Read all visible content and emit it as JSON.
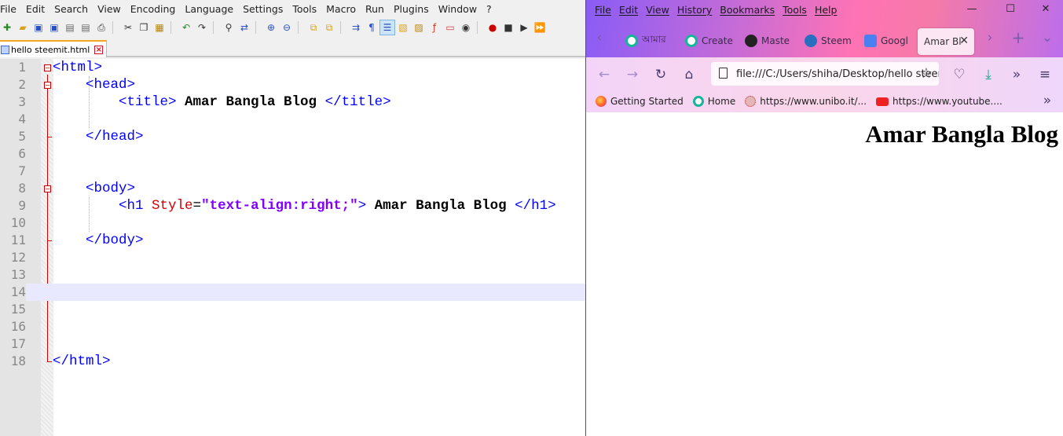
{
  "npp": {
    "menu": [
      "File",
      "Edit",
      "Search",
      "View",
      "Encoding",
      "Language",
      "Settings",
      "Tools",
      "Macro",
      "Run",
      "Plugins",
      "Window",
      "?"
    ],
    "tab_title": "hello steemit.html",
    "lines": [
      {
        "n": "1"
      },
      {
        "n": "2"
      },
      {
        "n": "3"
      },
      {
        "n": "4"
      },
      {
        "n": "5"
      },
      {
        "n": "6"
      },
      {
        "n": "7"
      },
      {
        "n": "8"
      },
      {
        "n": "9"
      },
      {
        "n": "10"
      },
      {
        "n": "11"
      },
      {
        "n": "12"
      },
      {
        "n": "13"
      },
      {
        "n": "14"
      },
      {
        "n": "15"
      },
      {
        "n": "16"
      },
      {
        "n": "17"
      },
      {
        "n": "18"
      }
    ],
    "code": {
      "l1": "<html>",
      "l2": "<head>",
      "l3_open": "<title>",
      "l3_text": " Amar Bangla Blog ",
      "l3_close": "</title>",
      "l5": "</head>",
      "l8": "<body>",
      "l9_open": "<h1 ",
      "l9_attr": "Style",
      "l9_eq": "=",
      "l9_val": "\"text-align:right;\"",
      "l9_gt": ">",
      "l9_text": " Amar Bangla Blog ",
      "l9_close": "</h1>",
      "l11": "</body>",
      "l18": "</html>"
    }
  },
  "firefox": {
    "menu": [
      "File",
      "Edit",
      "View",
      "History",
      "Bookmarks",
      "Tools",
      "Help"
    ],
    "tabs": [
      "আমার",
      "Create",
      "Maste",
      "Steem",
      "Googl"
    ],
    "active_tab": "Amar Bl",
    "url": "file:///C:/Users/shiha/Desktop/hello steemit.html",
    "bookmarks": [
      "Getting Started",
      "Home",
      "https://www.unibo.it/...",
      "https://www.youtube...."
    ],
    "page_heading": "Amar Bangla Blog",
    "colors": {
      "accent": "#ff73b4",
      "tag": "#0000ff",
      "attr": "#d10000",
      "value": "#8000ff"
    }
  }
}
